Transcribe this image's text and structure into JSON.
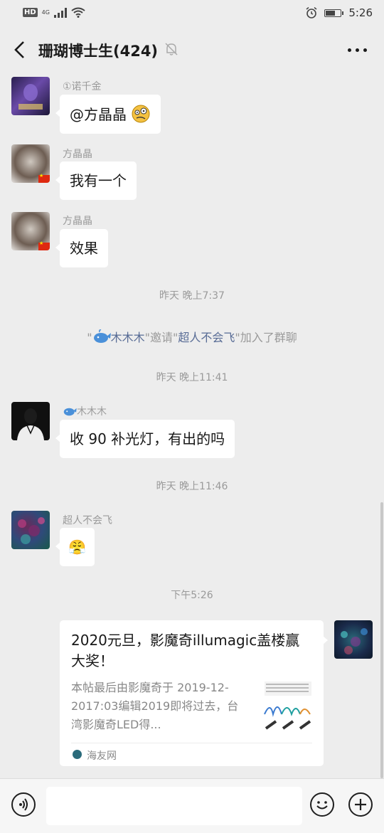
{
  "status": {
    "hd": "HD",
    "network": "4G",
    "time": "5:26",
    "battery_level": 0.7
  },
  "header": {
    "title": "珊瑚博士生(424)"
  },
  "messages": [
    {
      "sender": "①诺千金",
      "text": "@方晶晶 "
    },
    {
      "sender": "方晶晶",
      "text": "我有一个"
    },
    {
      "sender": "方晶晶",
      "text": "效果"
    },
    {
      "sender": "木木木",
      "text": "收 90 补光灯，有出的吗"
    },
    {
      "sender": "超人不会飞",
      "text": "😤"
    }
  ],
  "timestamps": [
    "昨天 晚上7:37",
    "昨天 晚上11:41",
    "昨天 晚上11:46",
    "下午5:26"
  ],
  "system_notice": {
    "q1": "\"",
    "inviter": "木木木",
    "mid": "\"邀请\"",
    "invitee": "超人不会飞",
    "end": "\"加入了群聊"
  },
  "card": {
    "title": "2020元旦，影魔奇illumagic盖楼赢大奖！",
    "description": "本帖最后由影魔奇于 2019-12-2017:03编辑2019即将过去，台湾影魔奇LED得...",
    "source": "海友网"
  },
  "colors": {
    "link": "#576b95",
    "background": "#ededed",
    "bubble": "#ffffff"
  }
}
